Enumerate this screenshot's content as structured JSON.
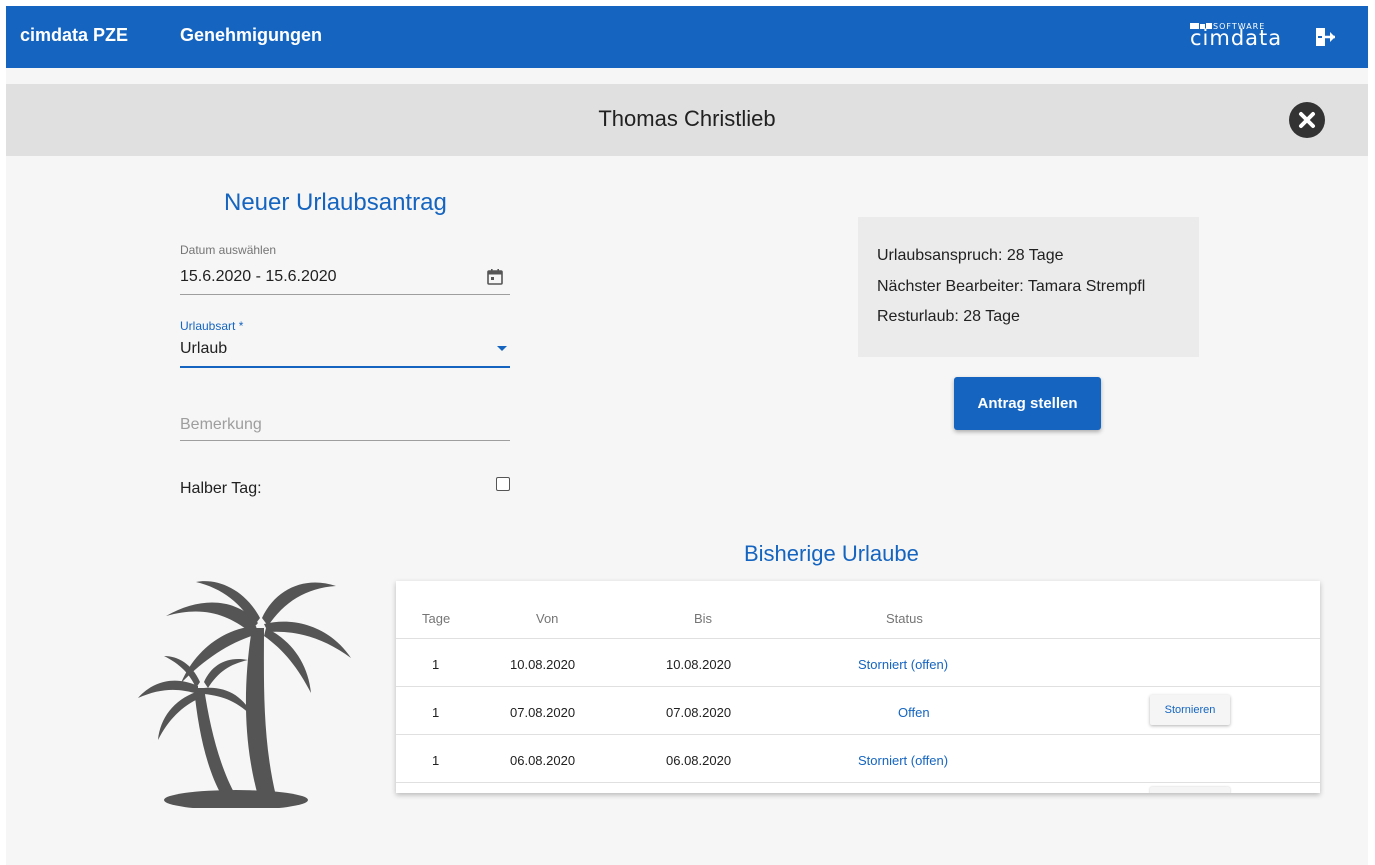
{
  "header": {
    "brand": "cimdata PZE",
    "nav_approvals": "Genehmigungen",
    "logo_sub": "SOFTWARE",
    "logo_main": "cimdata"
  },
  "employee": {
    "name": "Thomas Christlieb"
  },
  "form": {
    "title": "Neuer Urlaubsantrag",
    "date_label": "Datum auswählen",
    "date_value": "15.6.2020 - 15.6.2020",
    "type_label": "Urlaubsart *",
    "type_value": "Urlaub",
    "remark_placeholder": "Bemerkung",
    "half_day_label": "Halber Tag:",
    "half_day_checked": false
  },
  "info": {
    "entitlement": "Urlaubsanspruch: 28 Tage",
    "next_processor": "Nächster Bearbeiter: Tamara Strempfl",
    "remaining": "Resturlaub: 28 Tage",
    "submit_label": "Antrag stellen"
  },
  "history": {
    "title": "Bisherige Urlaube",
    "columns": [
      "Tage",
      "Von",
      "Bis",
      "Status"
    ],
    "rows": [
      {
        "days": "1",
        "from": "10.08.2020",
        "to": "10.08.2020",
        "status": "Storniert (offen)",
        "action": ""
      },
      {
        "days": "1",
        "from": "07.08.2020",
        "to": "07.08.2020",
        "status": "Offen",
        "action": "Stornieren"
      },
      {
        "days": "1",
        "from": "06.08.2020",
        "to": "06.08.2020",
        "status": "Storniert (offen)",
        "action": ""
      }
    ]
  },
  "colors": {
    "primary": "#1565c0",
    "title_bar": "#e0e0e0",
    "info_panel": "#ebebeb",
    "palm": "#555555"
  },
  "icons": {
    "calendar": "calendar-icon",
    "dropdown": "chevron-down-icon",
    "close": "close-icon",
    "logout": "logout-icon",
    "illustration": "palm-tree-icon"
  }
}
